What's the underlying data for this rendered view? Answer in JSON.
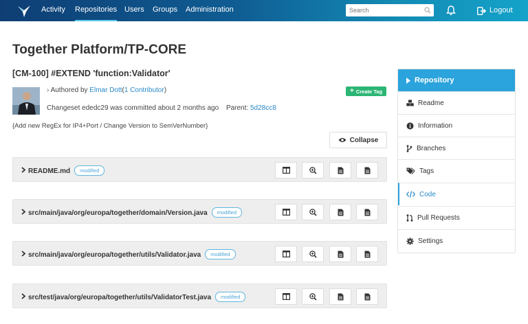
{
  "nav": {
    "items": [
      {
        "label": "Activity"
      },
      {
        "label": "Repositories"
      },
      {
        "label": "Users"
      },
      {
        "label": "Groups"
      },
      {
        "label": "Administration"
      }
    ],
    "search_placeholder": "Search",
    "logout_label": "Logout"
  },
  "page": {
    "title": "Together Platform/TP-CORE"
  },
  "commit": {
    "title": "[CM-100] #EXTEND 'function:Validator'",
    "authored_prefix": "Authored by",
    "author": "Elmar Dott",
    "contributors": "1 Contributor",
    "create_tag_label": "Create Tag",
    "changeset_text": "Changeset ededc29 was committed about 2 months ago",
    "parent_label": "Parent:",
    "parent_hash": "5d28cc8",
    "message": "{Add new RegEx for IP4+Port / Change Version to SemVerNumber}",
    "collapse_label": "Collapse"
  },
  "files": [
    {
      "path": "README.md",
      "status": "modified"
    },
    {
      "path": "src/main/java/org/europa/together/domain/Version.java",
      "status": "modified"
    },
    {
      "path": "src/main/java/org/europa/together/utils/Validator.java",
      "status": "modified"
    },
    {
      "path": "src/test/java/org/europa/together/utils/ValidatorTest.java",
      "status": "modified"
    }
  ],
  "sidebar": {
    "header": "Repository",
    "items": [
      {
        "label": "Readme",
        "icon": "cubes-icon"
      },
      {
        "label": "Information",
        "icon": "info-icon"
      },
      {
        "label": "Branches",
        "icon": "branch-icon"
      },
      {
        "label": "Tags",
        "icon": "tags-icon"
      },
      {
        "label": "Code",
        "icon": "code-icon"
      },
      {
        "label": "Pull Requests",
        "icon": "pull-request-icon"
      },
      {
        "label": "Settings",
        "icon": "gear-icon"
      }
    ]
  },
  "colors": {
    "nav_gradient_start": "#0e3e74",
    "nav_gradient_end": "#14a3c9",
    "accent": "#2ba3dc",
    "link": "#2a8ac8",
    "create_tag": "#2bb673"
  }
}
